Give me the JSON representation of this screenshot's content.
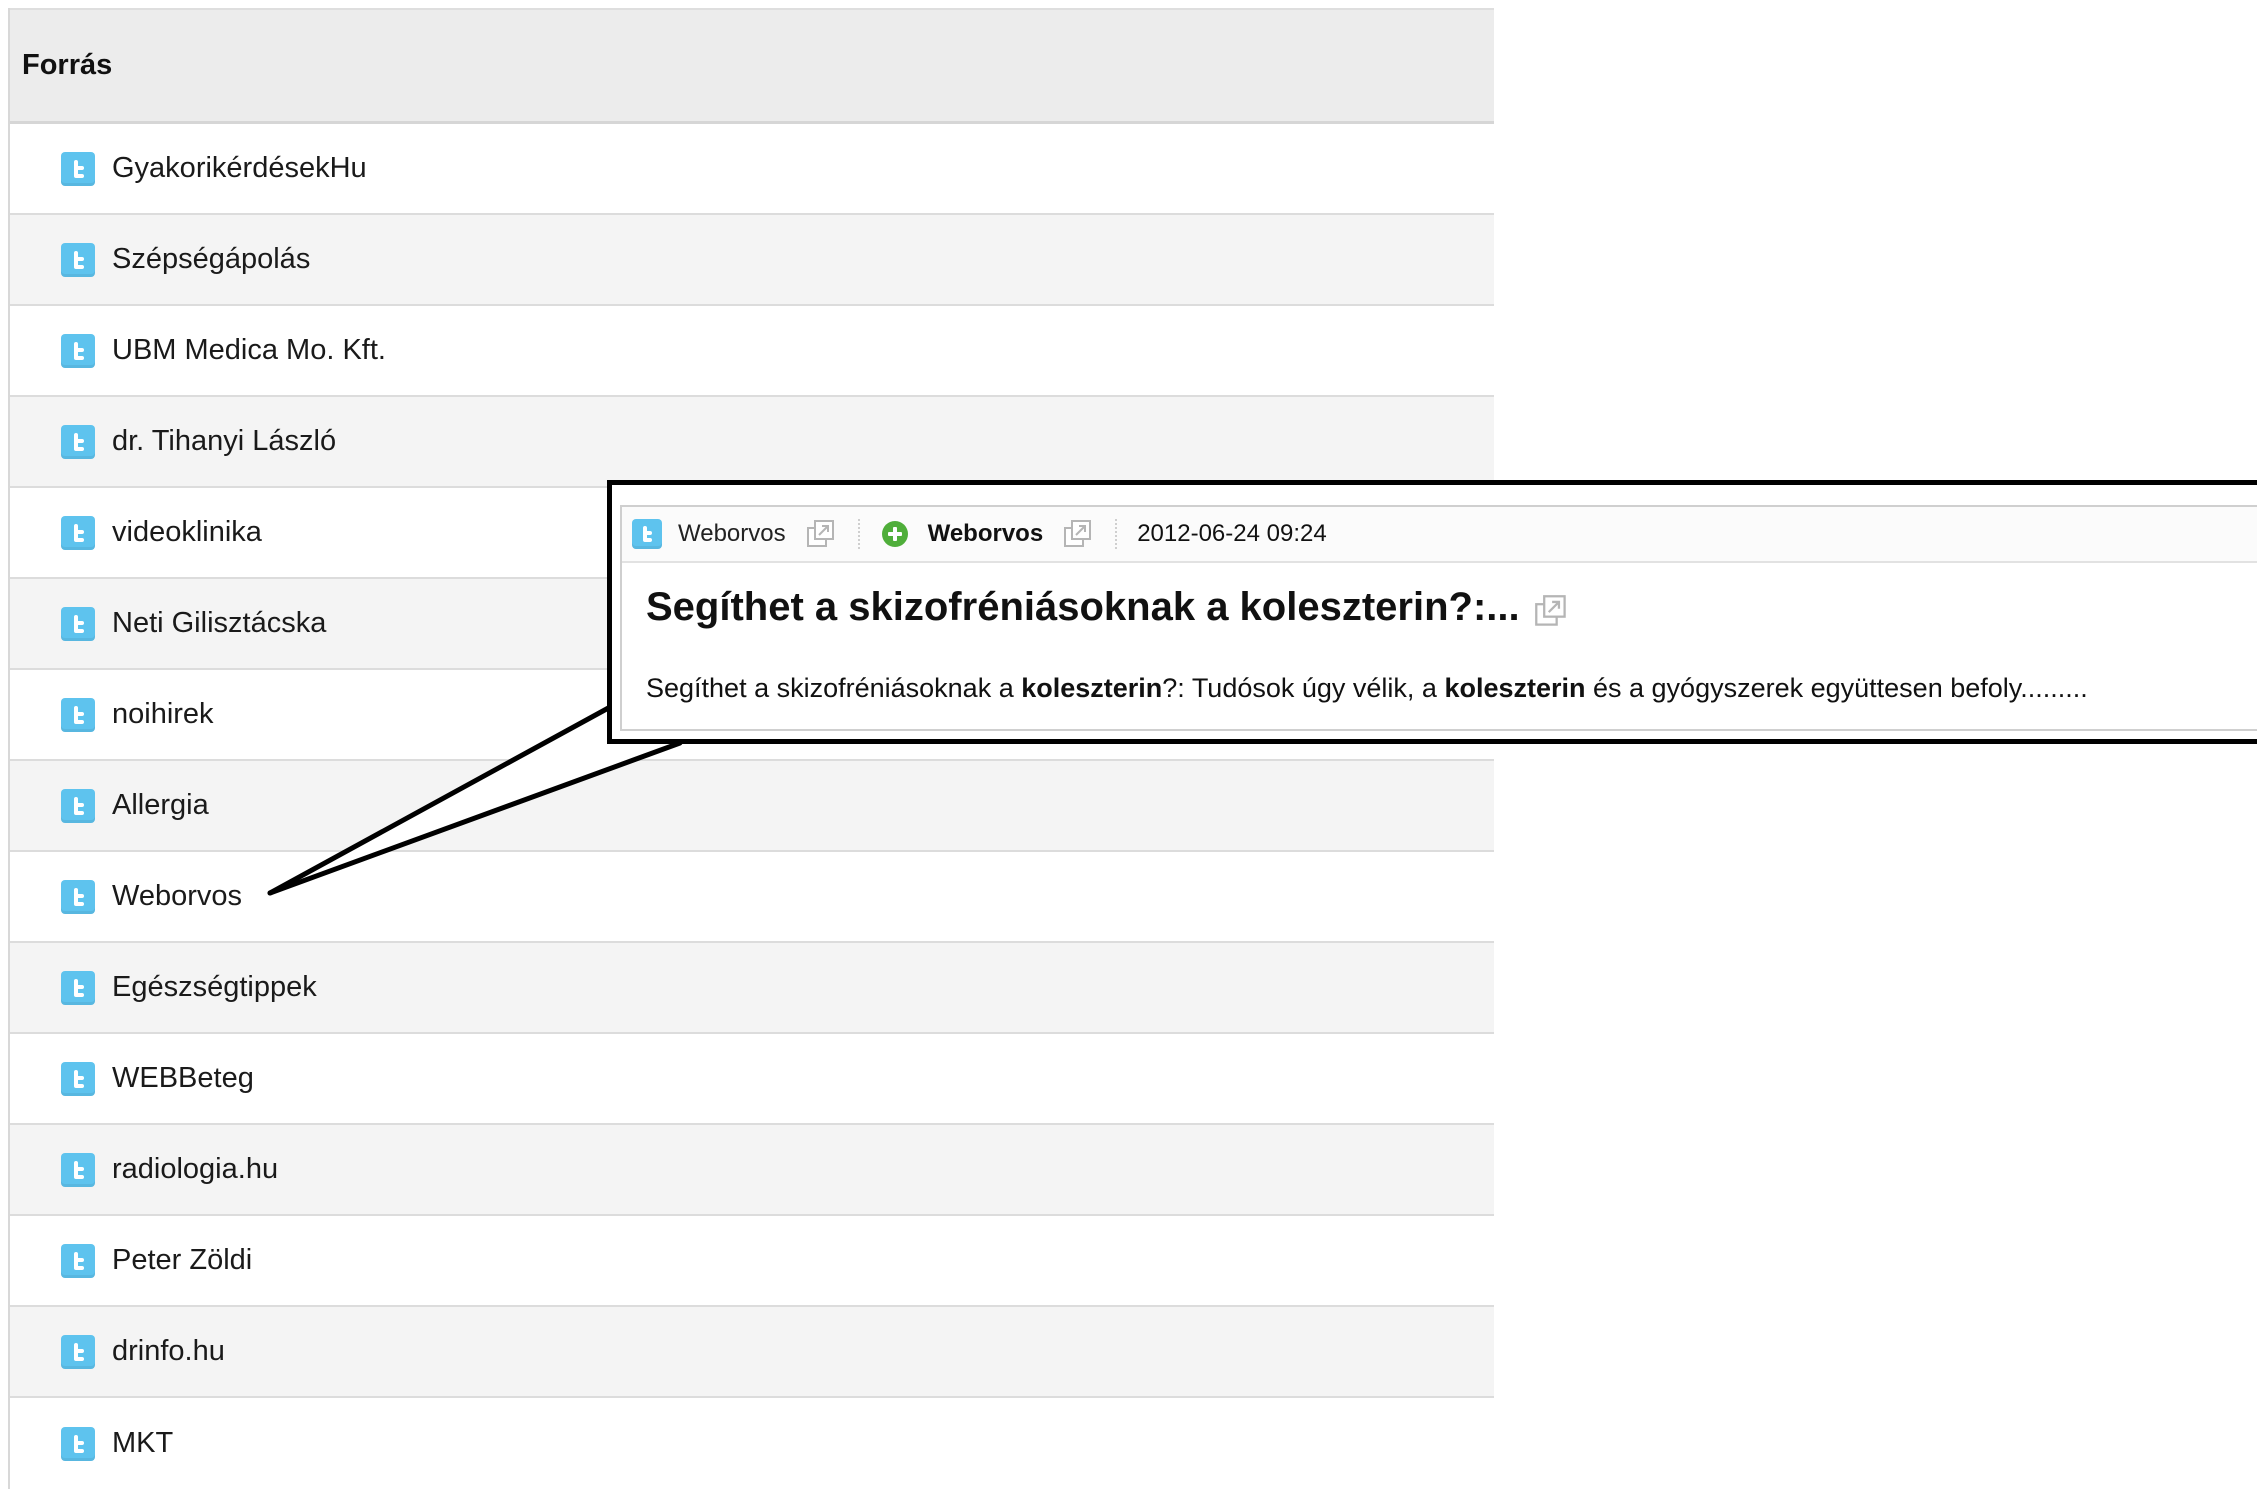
{
  "table": {
    "header": "Forrás",
    "rows": [
      "GyakorikérdésekHu",
      "Szépségápolás",
      "UBM Medica Mo. Kft.",
      "dr. Tihanyi László",
      "videoklinika",
      "Neti Gilisztácska",
      "noihirek",
      "Allergia",
      "Weborvos",
      "Egészségtippek",
      "WEBBeteg",
      "radiologia.hu",
      "Peter Zöldi",
      "drinfo.hu",
      "MKT"
    ]
  },
  "popup": {
    "source_name": "Weborvos",
    "author_name": "Weborvos",
    "date": "2012-06-24 09:24",
    "title": "Segíthet a skizofréniásoknak a koleszterin?:...",
    "body": {
      "part1": "Segíthet a skizofréniásoknak a ",
      "bold1": "koleszterin",
      "part2": "?: Tudósok úgy vélik, a ",
      "bold2": "koleszterin",
      "part3": " és a gyógyszerek együttesen befoly........."
    }
  },
  "colors": {
    "twitter_icon": "#5ec3ee",
    "plus_icon": "#4fae3a",
    "header_bg": "#ececec",
    "alt_row_bg": "#f4f4f4"
  },
  "icons": {
    "row_icon": "twitter-icon",
    "external": "external-link-icon",
    "add": "plus-icon"
  }
}
